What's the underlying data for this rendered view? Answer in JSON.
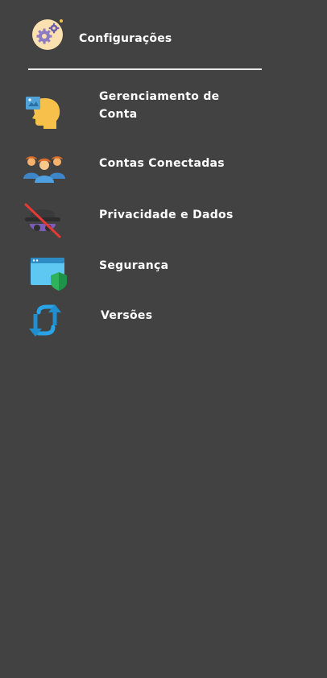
{
  "header": {
    "title": "Configurações",
    "icon": "settings-gears-icon",
    "icon_bg": "#fbe0b0"
  },
  "menu": {
    "items": [
      {
        "label": "Gerenciamento de Conta",
        "icon": "account-profile-head-icon"
      },
      {
        "label": "Contas Conectadas",
        "icon": "connected-users-group-icon"
      },
      {
        "label": "Privacidade e Dados",
        "icon": "privacy-spy-icon"
      },
      {
        "label": "Segurança",
        "icon": "security-shield-window-icon"
      },
      {
        "label": "Versões",
        "icon": "sync-arrows-icon"
      }
    ]
  },
  "colors": {
    "background": "#424242",
    "text": "#ffffff",
    "divider": "#e9e9e9"
  }
}
